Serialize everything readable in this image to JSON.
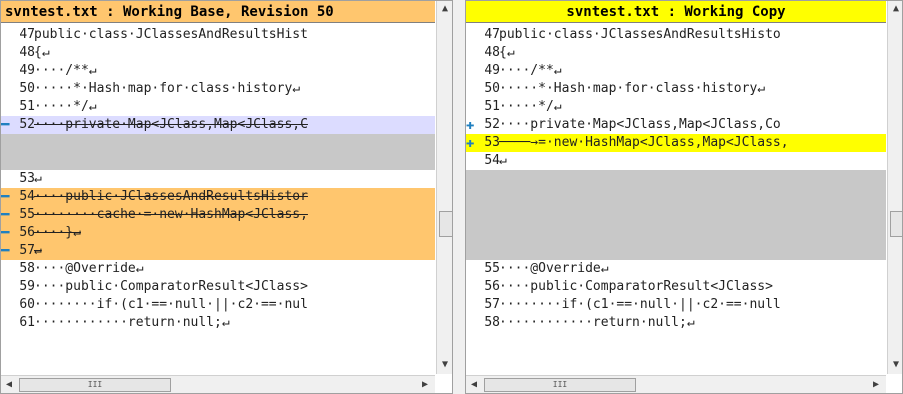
{
  "left": {
    "title": "svntest.txt : Working Base, Revision 50",
    "lines": [
      {
        "n": "47",
        "t": "public·class·JClassesAndResultsHist"
      },
      {
        "n": "48",
        "t": "{↵"
      },
      {
        "n": "49",
        "t": "····/**↵"
      },
      {
        "n": "50",
        "t": "·····*·Hash·map·for·class·history↵"
      },
      {
        "n": "51",
        "t": "·····*/↵"
      },
      {
        "n": "52",
        "t": "····private·Map<JClass,Map<JClass,C"
      },
      {
        "n": "",
        "t": ""
      },
      {
        "n": "",
        "t": ""
      },
      {
        "n": "53",
        "t": "↵"
      },
      {
        "n": "54",
        "t": "····public·JClassesAndResultsHistor"
      },
      {
        "n": "55",
        "t": "········cache·=·new·HashMap<JClass,"
      },
      {
        "n": "56",
        "t": "····}↵"
      },
      {
        "n": "57",
        "t": "↵"
      },
      {
        "n": "58",
        "t": "····@Override↵"
      },
      {
        "n": "59",
        "t": "····public·ComparatorResult<JClass>"
      },
      {
        "n": "60",
        "t": "········if·(c1·==·null·||·c2·==·nul"
      },
      {
        "n": "61",
        "t": "············return·null;↵"
      }
    ],
    "hthumb": "III"
  },
  "right": {
    "title": "svntest.txt : Working Copy",
    "lines": [
      {
        "n": "47",
        "t": "public·class·JClassesAndResultsHisto"
      },
      {
        "n": "48",
        "t": "{↵"
      },
      {
        "n": "49",
        "t": "····/**↵"
      },
      {
        "n": "50",
        "t": "·····*·Hash·map·for·class·history↵"
      },
      {
        "n": "51",
        "t": "·····*/↵"
      },
      {
        "n": "52",
        "t": "····private·Map<JClass,Map<JClass,Co"
      },
      {
        "n": "53",
        "t": "────→=·new·HashMap<JClass,Map<JClass,"
      },
      {
        "n": "54",
        "t": "↵"
      },
      {
        "n": "",
        "t": ""
      },
      {
        "n": "",
        "t": ""
      },
      {
        "n": "",
        "t": ""
      },
      {
        "n": "",
        "t": ""
      },
      {
        "n": "",
        "t": ""
      },
      {
        "n": "55",
        "t": "····@Override↵"
      },
      {
        "n": "56",
        "t": "····public·ComparatorResult<JClass>"
      },
      {
        "n": "57",
        "t": "········if·(c1·==·null·||·c2·==·null"
      },
      {
        "n": "58",
        "t": "············return·null;↵"
      }
    ],
    "hthumb": "III"
  },
  "icons": {
    "removed": "minus-marker-icon",
    "added": "plus-marker-icon"
  },
  "colors": {
    "left_title": "#ffc66e",
    "right_title": "#ffff00",
    "removed": "#ffc66e",
    "changed_left": "#dcdcff",
    "added": "#ffff00",
    "gap": "#c8c8c8"
  }
}
